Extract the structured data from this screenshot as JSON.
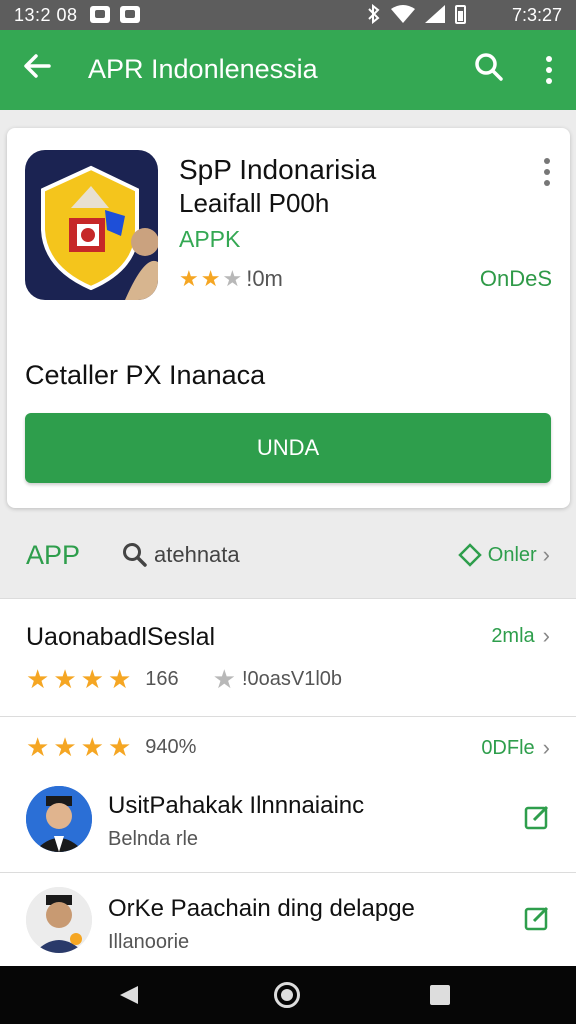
{
  "status_bar": {
    "time_left": "13:2 08",
    "time_right": "7:3:27",
    "icons": [
      "notification-icon",
      "notification-icon",
      "bluetooth-icon",
      "wifi-icon",
      "signal-icon",
      "battery-icon"
    ]
  },
  "app_bar": {
    "title": "APR Indonlenessia",
    "color": "#34a853",
    "icons": [
      "back-arrow-icon",
      "search-icon",
      "more-vert-icon"
    ]
  },
  "app_card": {
    "name": "SpP Indonarisia",
    "developer": "Leaifall P00h",
    "category": "APPK",
    "rating_value": 2.5,
    "rating_text": "!0m",
    "right_label": "OnDeS",
    "caption": "Cetaller PX Inanaca",
    "install_label": "UNDA"
  },
  "section": {
    "left_label": "APP",
    "search_text": "atehnata",
    "right_label": "Onler"
  },
  "rows": [
    {
      "title": "UaonabadlSeslal",
      "right_label": "2mla",
      "rating_value": 3.5,
      "meta_count": "166",
      "meta_text": "!0oasV1l0b"
    },
    {
      "rating_value": 3.5,
      "meta_count": "940%",
      "right_label": "0DFle"
    }
  ],
  "people": [
    {
      "name": "UsitPahakak Ilnnnaiainc",
      "subtitle": "Belnda rle"
    },
    {
      "name": "OrKe Paachain ding delapge",
      "subtitle": "Illanoorie"
    }
  ],
  "colors": {
    "accent": "#34a853",
    "button": "#2e9e4c",
    "star": "#f5a623"
  }
}
